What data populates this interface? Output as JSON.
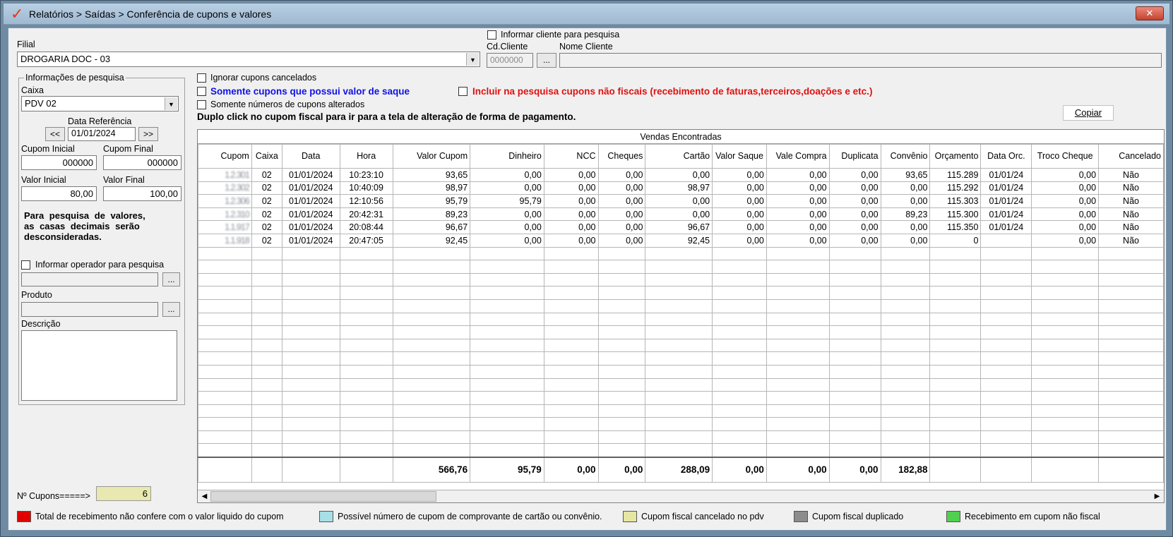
{
  "window": {
    "title": "Relatórios > Saídas > Conferência de cupons e valores",
    "close_label": "✕"
  },
  "filial": {
    "label": "Filial",
    "value": "DROGARIA DOC - 03"
  },
  "cliente": {
    "informar_label": "Informar cliente para pesquisa",
    "cd_label": "Cd.Cliente",
    "cd_placeholder": "0000000",
    "nome_label": "Nome Cliente",
    "nome_value": "",
    "lookup_label": "..."
  },
  "search_info": {
    "group_title": "Informações de pesquisa",
    "caixa_label": "Caixa",
    "caixa_value": "PDV 02",
    "data_ref_label": "Data Referência",
    "prev_label": "<<",
    "next_label": ">>",
    "data_ref_value": "01/01/2024",
    "cupom_inicial_label": "Cupom Inicial",
    "cupom_inicial_value": "000000",
    "cupom_final_label": "Cupom Final",
    "cupom_final_value": "000000",
    "valor_inicial_label": "Valor Inicial",
    "valor_inicial_value": "80,00",
    "valor_final_label": "Valor Final",
    "valor_final_value": "100,00",
    "hint_line1": "Para pesquisa de valores,",
    "hint_line2": "as casas decimais serão",
    "hint_line3": "desconsideradas.",
    "operador_label": "Informar operador para pesquisa",
    "operador_value": "",
    "produto_label": "Produto",
    "produto_value": "",
    "descricao_label": "Descrição",
    "lookup_label": "..."
  },
  "options": {
    "ignorar_cancelados": "Ignorar cupons cancelados",
    "somente_saque": "Somente cupons que possui valor de saque",
    "incluir_nao_fiscais": "Incluir na pesquisa cupons não fiscais (recebimento de faturas,terceiros,doações  e etc.)",
    "somente_alterados": "Somente números de cupons alterados",
    "instruction": "Duplo click no cupom fiscal para ir para a tela de alteração de forma de pagamento.",
    "copiar_label": "Copiar"
  },
  "grid": {
    "caption": "Vendas Encontradas",
    "columns": [
      "Cupom",
      "Caixa",
      "Data",
      "Hora",
      "Valor Cupom",
      "Dinheiro",
      "NCC",
      "Cheques",
      "Cartão",
      "Valor Saque",
      "Vale Compra",
      "Duplicata",
      "Convênio",
      "Orçamento",
      "Data Orc.",
      "Troco Cheque",
      "Cancelado"
    ],
    "rows": [
      [
        "1.2.301",
        "02",
        "01/01/2024",
        "10:23:10",
        "93,65",
        "0,00",
        "0,00",
        "0,00",
        "0,00",
        "0,00",
        "0,00",
        "0,00",
        "93,65",
        "115.289",
        "01/01/24",
        "0,00",
        "Não"
      ],
      [
        "1.2.302",
        "02",
        "01/01/2024",
        "10:40:09",
        "98,97",
        "0,00",
        "0,00",
        "0,00",
        "98,97",
        "0,00",
        "0,00",
        "0,00",
        "0,00",
        "115.292",
        "01/01/24",
        "0,00",
        "Não"
      ],
      [
        "1.2.306",
        "02",
        "01/01/2024",
        "12:10:56",
        "95,79",
        "95,79",
        "0,00",
        "0,00",
        "0,00",
        "0,00",
        "0,00",
        "0,00",
        "0,00",
        "115.303",
        "01/01/24",
        "0,00",
        "Não"
      ],
      [
        "1.2.310",
        "02",
        "01/01/2024",
        "20:42:31",
        "89,23",
        "0,00",
        "0,00",
        "0,00",
        "0,00",
        "0,00",
        "0,00",
        "0,00",
        "89,23",
        "115.300",
        "01/01/24",
        "0,00",
        "Não"
      ],
      [
        "1.1.917",
        "02",
        "01/01/2024",
        "20:08:44",
        "96,67",
        "0,00",
        "0,00",
        "0,00",
        "96,67",
        "0,00",
        "0,00",
        "0,00",
        "0,00",
        "115.350",
        "01/01/24",
        "0,00",
        "Não"
      ],
      [
        "1.1.918",
        "02",
        "01/01/2024",
        "20:47:05",
        "92,45",
        "0,00",
        "0,00",
        "0,00",
        "92,45",
        "0,00",
        "0,00",
        "0,00",
        "0,00",
        "0",
        "",
        "0,00",
        "Não"
      ]
    ],
    "totals": [
      "",
      "",
      "",
      "",
      "566,76",
      "95,79",
      "0,00",
      "0,00",
      "288,09",
      "0,00",
      "0,00",
      "0,00",
      "182,88",
      "",
      "",
      "",
      ""
    ]
  },
  "footer": {
    "cupons_label": "Nº Cupons=====>",
    "cupons_value": "6"
  },
  "legend": [
    {
      "color": "#e00000",
      "label": "Total de recebimento não confere com o valor liquido do cupom"
    },
    {
      "color": "#a8dfe6",
      "label": "Possível número de cupom de comprovante de cartão ou convênio."
    },
    {
      "color": "#e6e6a4",
      "label": "Cupom fiscal cancelado no pdv"
    },
    {
      "color": "#8c8c8c",
      "label": "Cupom fiscal duplicado"
    },
    {
      "color": "#4fd04f",
      "label": "Recebimento em cupom não fiscal"
    }
  ]
}
